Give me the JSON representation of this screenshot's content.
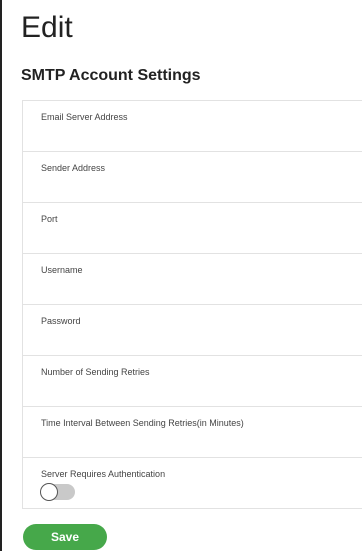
{
  "page": {
    "title": "Edit",
    "subtitle": "SMTP Account Settings"
  },
  "form": {
    "fields": [
      {
        "label": "Email Server Address",
        "value": ""
      },
      {
        "label": "Sender Address",
        "value": ""
      },
      {
        "label": "Port",
        "value": ""
      },
      {
        "label": "Username",
        "value": ""
      },
      {
        "label": "Password",
        "value": ""
      },
      {
        "label": "Number of Sending Retries",
        "value": ""
      },
      {
        "label": "Time Interval Between Sending Retries(in Minutes)",
        "value": ""
      }
    ],
    "auth": {
      "label": "Server Requires Authentication",
      "enabled": false,
      "toggle_icon": "toggle-off-icon"
    }
  },
  "actions": {
    "save_label": "Save",
    "save_color": "#46a84a"
  }
}
